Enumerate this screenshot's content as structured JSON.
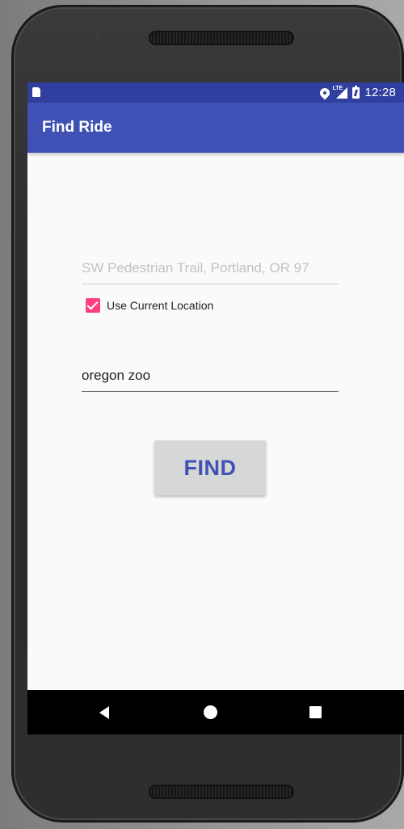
{
  "status_bar": {
    "time": "12:28",
    "network_label": "LTE",
    "icons": [
      "sd-card-icon",
      "location-icon",
      "lte-signal-icon",
      "battery-icon"
    ]
  },
  "app_bar": {
    "title": "Find Ride"
  },
  "form": {
    "origin": {
      "value": "",
      "placeholder": "SW Pedestrian Trail, Portland, OR 97"
    },
    "use_current_location": {
      "label": "Use Current Location",
      "checked": true
    },
    "destination": {
      "value": "oregon zoo",
      "placeholder": ""
    },
    "find_button_label": "FIND"
  },
  "nav_bar": {
    "icons": [
      "back-icon",
      "home-icon",
      "recents-icon"
    ]
  },
  "colors": {
    "primary": "#3f51b5",
    "primary_dark": "#303f9f",
    "accent": "#ff4081",
    "button_bg": "#d6d7d7"
  }
}
